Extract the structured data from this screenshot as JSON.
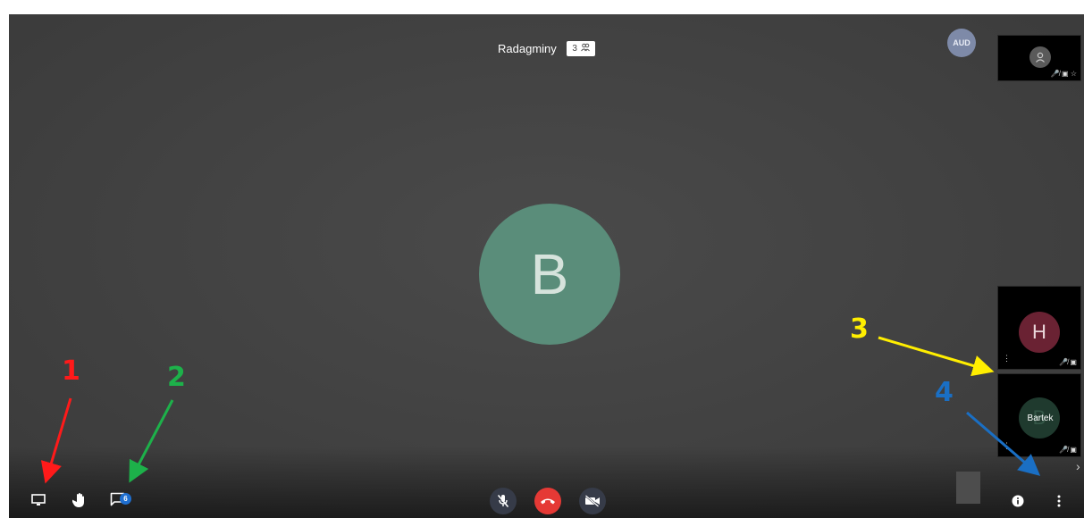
{
  "room": {
    "title": "Radagminy",
    "participant_count": "3"
  },
  "main_participant": {
    "initial": "B",
    "color": "#5a8d7a"
  },
  "filmstrip": {
    "aud_label": "AUD",
    "tiles": [
      {
        "initial": "",
        "icons": "🎤̸ ▣ ☆"
      },
      {
        "initial": "H",
        "color": "#6a2233",
        "icons": "🎤̸ ▣"
      },
      {
        "initial": "B",
        "name": "Bartek",
        "color": "#1f3a2e",
        "icons": "🎤̸ ▣"
      }
    ],
    "scroll_label": "›"
  },
  "toolbar": {
    "chat_unread_count": "6",
    "left": [
      "desktop-share",
      "raise-hand",
      "chat"
    ],
    "center": [
      "mute-microphone",
      "hangup",
      "video-off"
    ],
    "right": [
      "info",
      "more-options"
    ]
  },
  "annotations": [
    {
      "label": "1",
      "color": "#ff1a1a"
    },
    {
      "label": "2",
      "color": "#1db14a"
    },
    {
      "label": "3",
      "color": "#ffee00"
    },
    {
      "label": "4",
      "color": "#1a6fc4"
    }
  ],
  "colors": {
    "hangup": "#e53935",
    "call_button": "#363b48",
    "badge": "#1f6fd0"
  }
}
